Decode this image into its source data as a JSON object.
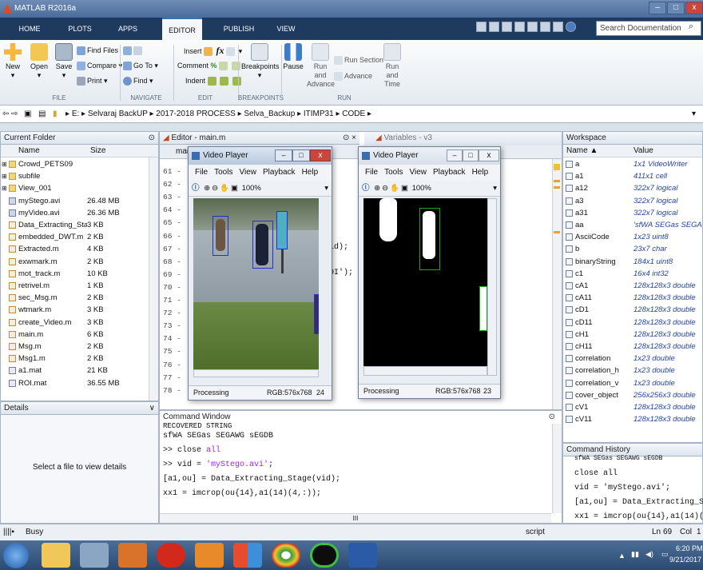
{
  "window": {
    "title": "MATLAB R2016a"
  },
  "tabs": [
    "HOME",
    "PLOTS",
    "APPS",
    "EDITOR",
    "PUBLISH",
    "VIEW"
  ],
  "active_tab": "EDITOR",
  "search_placeholder": "Search Documentation",
  "toolstrip": {
    "file": {
      "new": "New",
      "open": "Open",
      "save": "Save",
      "find_files": "Find Files",
      "compare": "Compare",
      "print": "Print",
      "group": "FILE"
    },
    "navigate": {
      "go_to": "Go To",
      "find": "Find",
      "group": "NAVIGATE"
    },
    "edit": {
      "insert": "Insert",
      "comment": "Comment",
      "indent": "Indent",
      "fx": "fx",
      "group": "EDIT"
    },
    "breakpoints": {
      "breakpoints": "Breakpoints",
      "group": "BREAKPOINTS"
    },
    "run": {
      "pause": "Pause",
      "run_and_advance": "Run and Advance",
      "run_section": "Run Section",
      "advance": "Advance",
      "run_and_time": "Run and Time",
      "group": "RUN"
    }
  },
  "breadcrumb": [
    "E:",
    "Selvaraj BackUP",
    "2017-2018 PROCESS",
    "Selva_Backup",
    "ITIMP31",
    "CODE"
  ],
  "current_folder": {
    "title": "Current Folder",
    "col_name": "Name",
    "col_size": "Size",
    "files": [
      {
        "name": "Crowd_PETS09",
        "size": "",
        "type": "folder"
      },
      {
        "name": "subfile",
        "size": "",
        "type": "folder"
      },
      {
        "name": "View_001",
        "size": "",
        "type": "folder"
      },
      {
        "name": "myStego.avi",
        "size": "26.48 MB",
        "type": "avi"
      },
      {
        "name": "myVideo.avi",
        "size": "26.36 MB",
        "type": "avi"
      },
      {
        "name": "Data_Extracting_Sta...",
        "size": "3 KB",
        "type": "m"
      },
      {
        "name": "embedded_DWT.m",
        "size": "2 KB",
        "type": "m"
      },
      {
        "name": "Extracted.m",
        "size": "4 KB",
        "type": "m"
      },
      {
        "name": "exwmark.m",
        "size": "2 KB",
        "type": "m"
      },
      {
        "name": "mot_track.m",
        "size": "10 KB",
        "type": "m"
      },
      {
        "name": "retrivel.m",
        "size": "1 KB",
        "type": "m"
      },
      {
        "name": "sec_Msg.m",
        "size": "2 KB",
        "type": "m"
      },
      {
        "name": "wtmark.m",
        "size": "3 KB",
        "type": "m"
      },
      {
        "name": "create_Video.m",
        "size": "3 KB",
        "type": "m"
      },
      {
        "name": "main.m",
        "size": "6 KB",
        "type": "m"
      },
      {
        "name": "Msg.m",
        "size": "2 KB",
        "type": "m"
      },
      {
        "name": "Msg1.m",
        "size": "2 KB",
        "type": "m"
      },
      {
        "name": "a1.mat",
        "size": "21 KB",
        "type": "mat"
      },
      {
        "name": "ROI.mat",
        "size": "36.55 MB",
        "type": "mat"
      }
    ]
  },
  "details": {
    "title": "Details",
    "message": "Select a file to view details"
  },
  "editor": {
    "title": "Editor - main.m",
    "tab": "main",
    "tab2": "V",
    "lines": [
      "61",
      "62",
      "63",
      "64",
      "65",
      "66",
      "67",
      "68",
      "69",
      "70",
      "71",
      "72",
      "73",
      "74",
      "75",
      "76",
      "77",
      "78"
    ],
    "code_frag1": "id);",
    "code_frag2": "OI');"
  },
  "variables_title": "Variables - v3",
  "video_player_left": {
    "title": "Video Player",
    "menu": [
      "File",
      "Tools",
      "View",
      "Playback",
      "Help"
    ],
    "zoom": "100%",
    "status": "Processing",
    "rgb": "RGB:576x768",
    "frame": "24"
  },
  "video_player_right": {
    "title": "Video Player",
    "menu": [
      "File",
      "Tools",
      "View",
      "Playback",
      "Help"
    ],
    "zoom": "100%",
    "status": "Processing",
    "rgb": "RGB:576x768",
    "frame": "23"
  },
  "command_window": {
    "title": "Command Window",
    "line0": "RECOVERED STRING",
    "line1": "sfWA SEGas SEGAWG sEGDB",
    "line2_prompt": ">> close ",
    "line2_kw": "all",
    "line3_a": ">> vid = ",
    "line3_str": "'myStego.avi'",
    "line3_b": ";",
    "line4": "[a1,ou] = Data_Extracting_Stage(vid);",
    "line5": "xx1 = imcrop(ou{14},a1(14)(4,:));",
    "scroll_marker": "III"
  },
  "workspace": {
    "title": "Workspace",
    "col_name": "Name ▲",
    "col_value": "Value",
    "vars": [
      {
        "name": "a",
        "value": "1x1 VideoWriter"
      },
      {
        "name": "a1",
        "value": "411x1 cell"
      },
      {
        "name": "a12",
        "value": "322x7 logical"
      },
      {
        "name": "a3",
        "value": "322x7 logical"
      },
      {
        "name": "a31",
        "value": "322x7 logical"
      },
      {
        "name": "aa",
        "value": "'sfWA SEGas SEGAW..."
      },
      {
        "name": "AsciiCode",
        "value": "1x23 uint8"
      },
      {
        "name": "b",
        "value": "23x7 char"
      },
      {
        "name": "binaryString",
        "value": "184x1 uint8"
      },
      {
        "name": "c1",
        "value": "16x4 int32"
      },
      {
        "name": "cA1",
        "value": "128x128x3 double"
      },
      {
        "name": "cA11",
        "value": "128x128x3 double"
      },
      {
        "name": "cD1",
        "value": "128x128x3 double"
      },
      {
        "name": "cD11",
        "value": "128x128x3 double"
      },
      {
        "name": "cH1",
        "value": "128x128x3 double"
      },
      {
        "name": "cH11",
        "value": "128x128x3 double"
      },
      {
        "name": "correlation",
        "value": "1x23 double"
      },
      {
        "name": "correlation_h",
        "value": "1x23 double"
      },
      {
        "name": "correlation_v",
        "value": "1x23 double"
      },
      {
        "name": "cover_object",
        "value": "256x256x3 double"
      },
      {
        "name": "cV1",
        "value": "128x128x3 double"
      },
      {
        "name": "cV11",
        "value": "128x128x3 double"
      }
    ]
  },
  "history": {
    "title": "Command History",
    "lines": [
      "sfWA SEGas SEGAWG sEGDB",
      "close all",
      "vid = 'myStego.avi';",
      "[a1,ou] = Data_Extracting_S...",
      "xx1 = imcrop(ou{14},a1(14)(..."
    ]
  },
  "statusbar": {
    "state": "Busy",
    "mode": "script",
    "ln_label": "Ln",
    "ln": "69",
    "col_label": "Col",
    "col": "1"
  },
  "taskbar": {
    "time": "6:20 PM",
    "date": "9/21/2017"
  }
}
